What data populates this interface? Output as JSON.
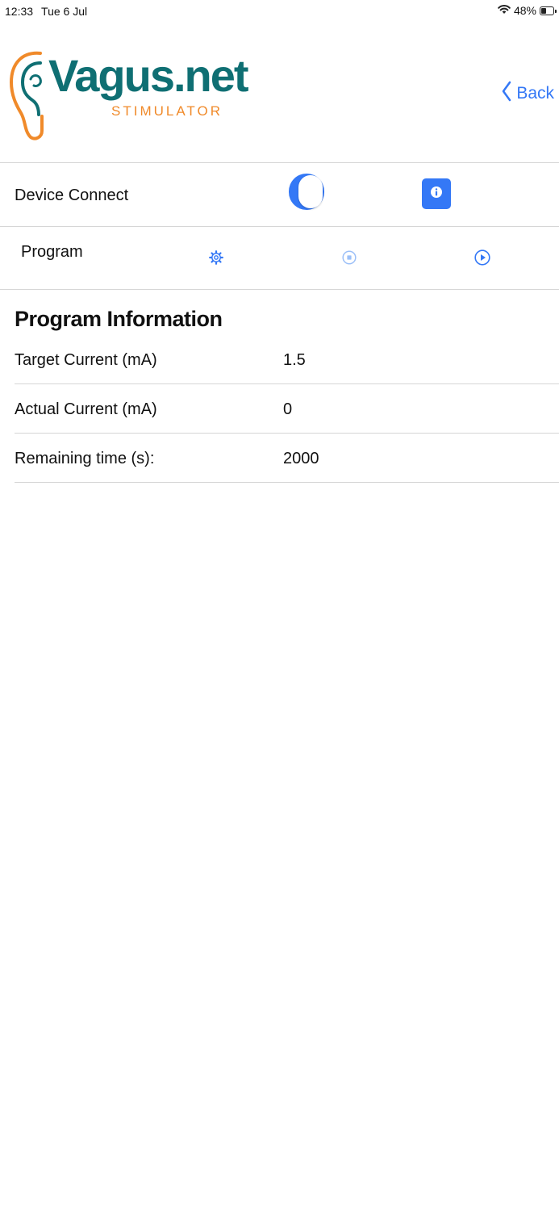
{
  "status_bar": {
    "time": "12:33",
    "date": "Tue 6 Jul",
    "battery": "48%",
    "icons": [
      "wifi-icon",
      "battery-icon"
    ]
  },
  "header": {
    "logo_title": "Vagus.net",
    "logo_subtitle": "STIMULATOR",
    "back_label": "Back",
    "colors": {
      "teal": "#0f6f73",
      "orange": "#f08a2a",
      "accent": "#3478f6"
    }
  },
  "device": {
    "label": "Device Connect",
    "toggle_on": true,
    "info_icon": "info-icon"
  },
  "program": {
    "label": "Program",
    "icons": [
      "settings-gear-icon",
      "stop-icon",
      "play-icon"
    ]
  },
  "program_info": {
    "title": "Program Information",
    "rows": [
      {
        "label": "Target Current (mA)",
        "value": "1.5"
      },
      {
        "label": "Actual Current (mA)",
        "value": "0"
      },
      {
        "label": "Remaining time (s):",
        "value": "2000"
      }
    ]
  }
}
